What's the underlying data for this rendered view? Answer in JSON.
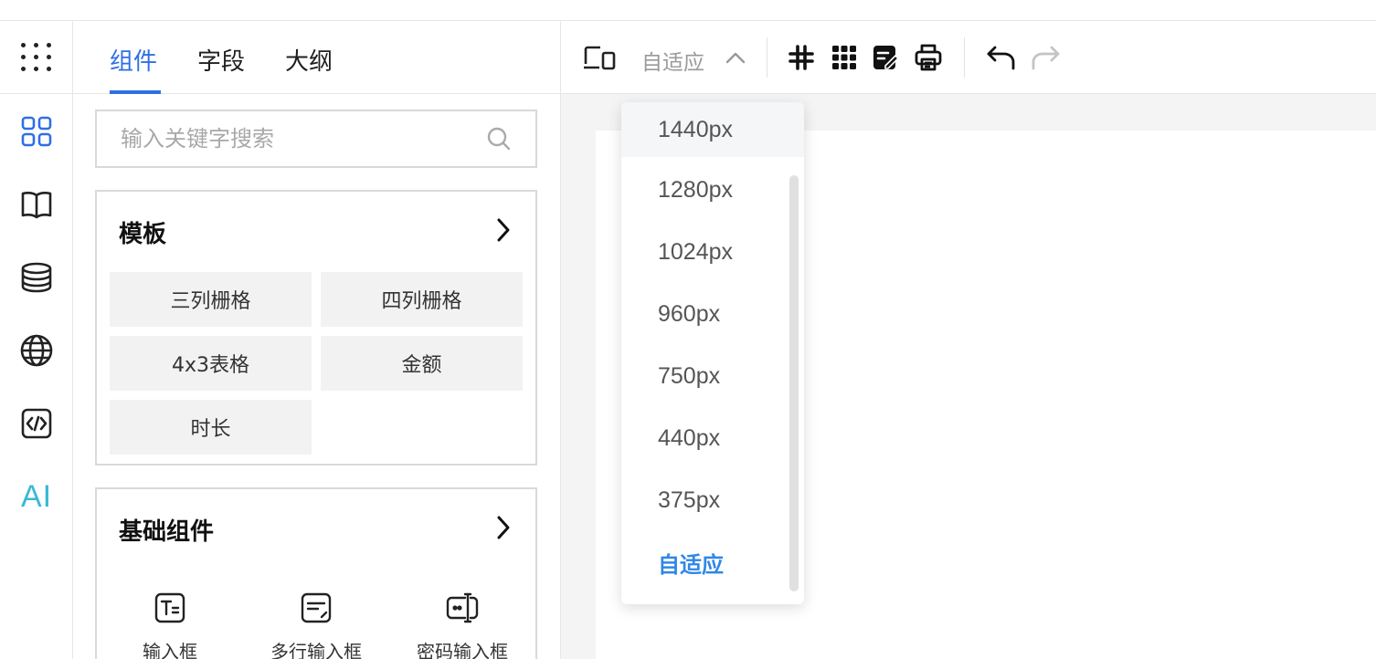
{
  "rail": {
    "items": [
      "grid-icon",
      "book-icon",
      "database-icon",
      "globe-icon",
      "code-icon"
    ],
    "ai_label": "AI"
  },
  "tabs": [
    "组件",
    "字段",
    "大纲"
  ],
  "search": {
    "placeholder": "输入关键字搜索"
  },
  "templates": {
    "title": "模板",
    "items": [
      "三列栅格",
      "四列栅格",
      "4x3表格",
      "金额",
      "时长"
    ]
  },
  "basic": {
    "title": "基础组件",
    "items": [
      "输入框",
      "多行输入框",
      "密码输入框"
    ]
  },
  "toolbar": {
    "mode_label": "自适应"
  },
  "dropdown": {
    "options": [
      "1440px",
      "1280px",
      "1024px",
      "960px",
      "750px",
      "440px",
      "375px",
      "自适应"
    ],
    "selected": "自适应",
    "hovered": "1440px"
  },
  "colors": {
    "accent": "#2f6fe4",
    "ai": "#3ab8d4",
    "selected": "#2f87e8"
  }
}
